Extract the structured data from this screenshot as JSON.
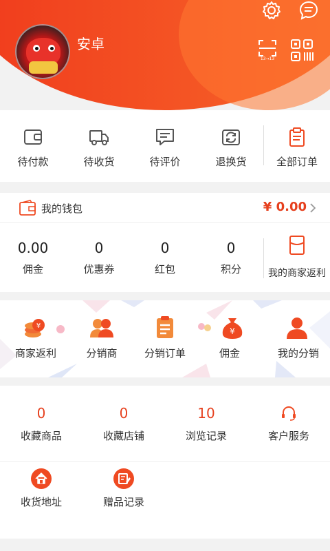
{
  "profile": {
    "username": "安卓",
    "avatar": "avatar-image"
  },
  "header": {
    "icons": [
      "settings-icon",
      "message-icon",
      "scan-icon",
      "qrcode-icon"
    ],
    "accent": "#f0421e"
  },
  "orders": {
    "items": [
      {
        "label": "待付款",
        "icon": "wallet-icon"
      },
      {
        "label": "待收货",
        "icon": "truck-icon"
      },
      {
        "label": "待评价",
        "icon": "comment-icon"
      },
      {
        "label": "退换货",
        "icon": "exchange-icon"
      },
      {
        "label": "全部订单",
        "icon": "clipboard-icon"
      }
    ]
  },
  "wallet": {
    "title": "我的钱包",
    "amount": "¥ 0.00",
    "stats": [
      {
        "value": "0.00",
        "label": "佣金"
      },
      {
        "value": "0",
        "label": "优惠券"
      },
      {
        "value": "0",
        "label": "红包"
      },
      {
        "value": "0",
        "label": "积分"
      }
    ],
    "merchant_label": "我的商家返利"
  },
  "tools": {
    "items": [
      {
        "label": "商家返利",
        "icon": "coins-icon"
      },
      {
        "label": "分销商",
        "icon": "people-icon"
      },
      {
        "label": "分销订单",
        "icon": "order-list-icon"
      },
      {
        "label": "佣金",
        "icon": "money-bag-icon"
      },
      {
        "label": "我的分销",
        "icon": "person-icon"
      }
    ]
  },
  "favorites": {
    "items": [
      {
        "value": "0",
        "label": "收藏商品"
      },
      {
        "value": "0",
        "label": "收藏店铺"
      },
      {
        "value": "10",
        "label": "浏览记录"
      }
    ],
    "service_label": "客户服务",
    "address_label": "收货地址",
    "gift_label": "赠品记录"
  }
}
